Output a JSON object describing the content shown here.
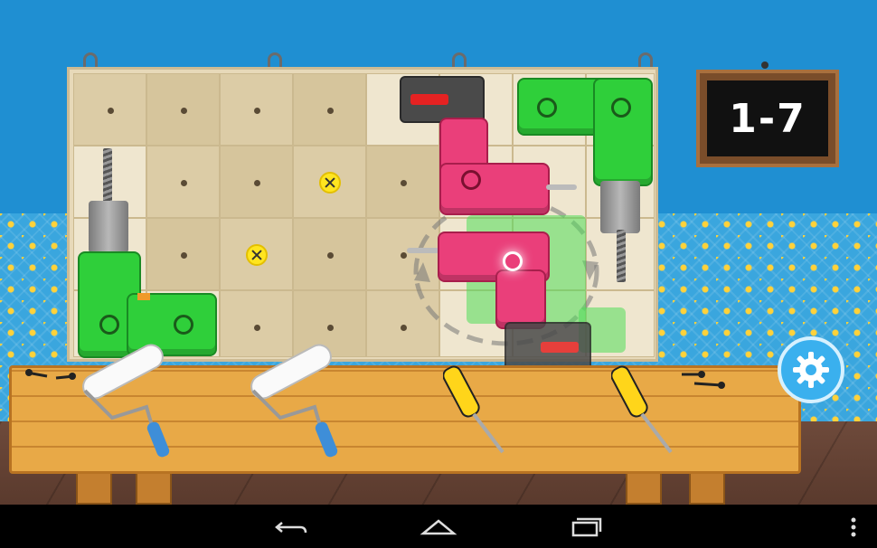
{
  "level": {
    "label": "1-7"
  },
  "board": {
    "rows": 4,
    "cols": 8
  },
  "tools_on_table": [
    "paint-roller",
    "paint-roller",
    "screwdriver",
    "screwdriver"
  ],
  "icons": {
    "settings": "gear-icon",
    "back": "back-icon",
    "home": "home-icon",
    "recent": "recent-apps-icon",
    "menu": "overflow-menu-icon"
  },
  "colors": {
    "wall": "#1f8fd2",
    "drill_green": "#2fcf3a",
    "drill_pink": "#ea3f7a",
    "table": "#e8a947"
  }
}
